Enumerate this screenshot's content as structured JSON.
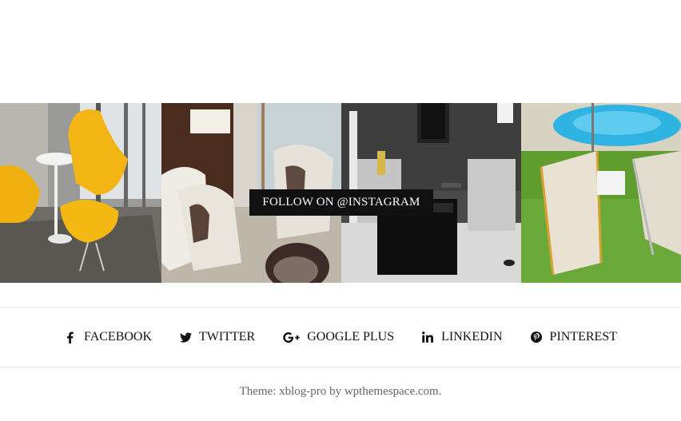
{
  "instagram": {
    "follow_label": "FOLLOW ON @INSTAGRAM",
    "tiles": [
      {
        "name": "yellow-chairs-photo"
      },
      {
        "name": "white-armchairs-photo"
      },
      {
        "name": "living-room-photo"
      },
      {
        "name": "pool-deckchairs-photo"
      }
    ]
  },
  "social": {
    "links": [
      {
        "label": "FACEBOOK",
        "icon": "facebook-icon"
      },
      {
        "label": "TWITTER",
        "icon": "twitter-icon"
      },
      {
        "label": "GOOGLE PLUS",
        "icon": "google-plus-icon"
      },
      {
        "label": "LINKEDIN",
        "icon": "linkedin-icon"
      },
      {
        "label": "PINTEREST",
        "icon": "pinterest-icon"
      }
    ]
  },
  "footer": {
    "prefix": "Theme: ",
    "theme_name": "xblog-pro",
    "by": " by ",
    "author": "wpthemespace.com",
    "suffix": "."
  }
}
